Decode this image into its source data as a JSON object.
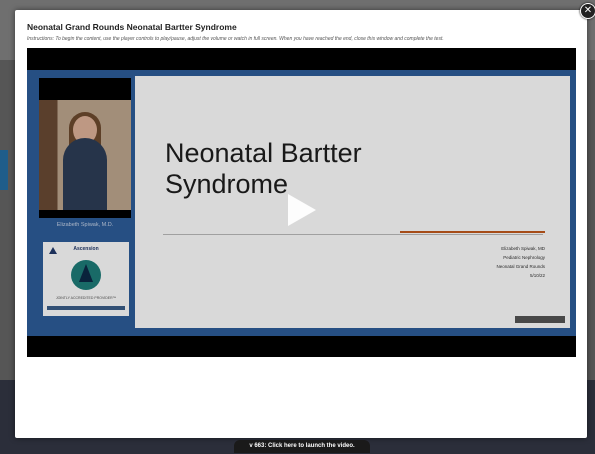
{
  "modal": {
    "title": "Neonatal Grand Rounds Neonatal Bartter Syndrome",
    "instructions": "Instructions: To begin the content, use the player controls to play/pause, adjust the volume or watch in full screen. When you have reached the end, close this window and complete the test.",
    "close_icon": "close-icon"
  },
  "video": {
    "presenter_name": "Elizabeth Spiwak, M.D.",
    "logo": {
      "name": "Ascension",
      "tagline": "JOINTLY ACCREDITED PROVIDER™"
    },
    "slide": {
      "title": "Neonatal Bartter Syndrome",
      "meta": [
        "Elizabeth Spiwak, MD",
        "Pediatric Nephrology",
        "Neonatal Grand Rounds",
        "5/10/22"
      ]
    },
    "play_icon": "play-icon"
  },
  "footer": {
    "launch_label": "v 663: Click here to launch the video."
  }
}
